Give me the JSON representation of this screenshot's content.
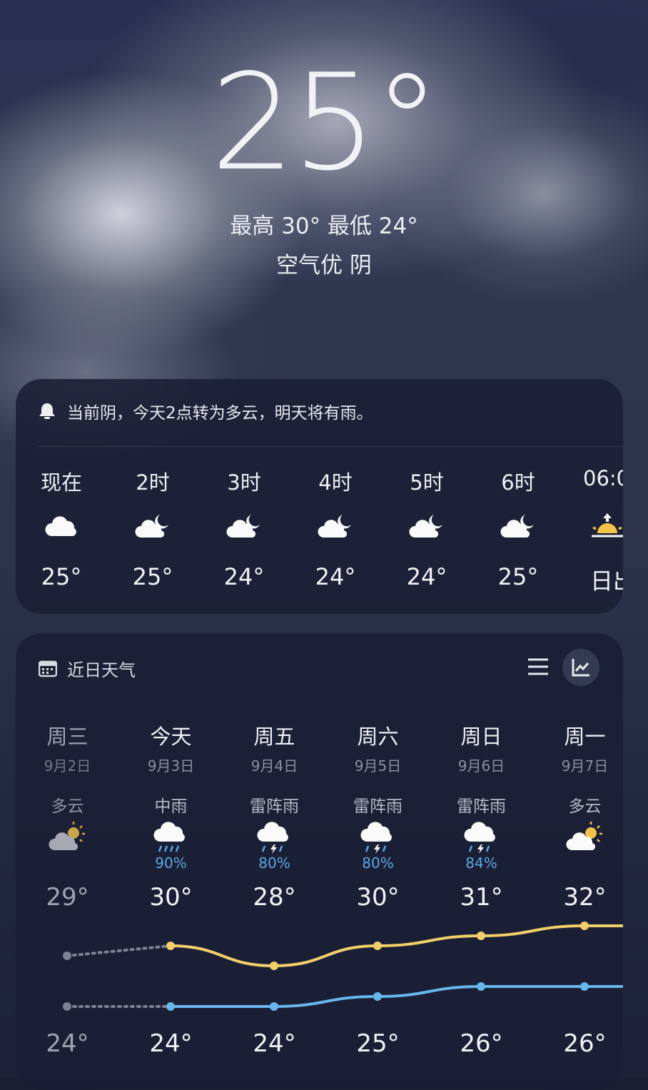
{
  "current": {
    "temperature": "25°",
    "high_low": "最高 30° 最低 24°",
    "air_and_condition": "空气优  阴"
  },
  "alert": {
    "text": "当前阴，今天2点转为多云，明天将有雨。",
    "icon": "bell-icon"
  },
  "hourly": [
    {
      "time": "现在",
      "icon": "cloudy-icon",
      "temp": "25°"
    },
    {
      "time": "2时",
      "icon": "partly-cloudy-night-icon",
      "temp": "25°"
    },
    {
      "time": "3时",
      "icon": "partly-cloudy-night-icon",
      "temp": "24°"
    },
    {
      "time": "4时",
      "icon": "partly-cloudy-night-icon",
      "temp": "24°"
    },
    {
      "time": "5时",
      "icon": "partly-cloudy-night-icon",
      "temp": "24°"
    },
    {
      "time": "6时",
      "icon": "partly-cloudy-night-icon",
      "temp": "25°"
    },
    {
      "time": "06:0",
      "icon": "sunrise-icon",
      "temp": "日出"
    }
  ],
  "forecast": {
    "title": "近日天气",
    "title_icon": "calendar-icon",
    "list_view_icon": "list-view-icon",
    "chart_view_icon": "chart-view-icon",
    "days": [
      {
        "weekday": "周三",
        "date": "9月2日",
        "condition": "多云",
        "icon": "partly-cloudy-day-icon",
        "precip": "",
        "high": "29°",
        "low": "24°",
        "past": true
      },
      {
        "weekday": "今天",
        "date": "9月3日",
        "condition": "中雨",
        "icon": "rain-icon",
        "precip": "90%",
        "high": "30°",
        "low": "24°",
        "past": false
      },
      {
        "weekday": "周五",
        "date": "9月4日",
        "condition": "雷阵雨",
        "icon": "thunderstorm-icon",
        "precip": "80%",
        "high": "28°",
        "low": "24°",
        "past": false
      },
      {
        "weekday": "周六",
        "date": "9月5日",
        "condition": "雷阵雨",
        "icon": "thunderstorm-icon",
        "precip": "80%",
        "high": "30°",
        "low": "25°",
        "past": false
      },
      {
        "weekday": "周日",
        "date": "9月6日",
        "condition": "雷阵雨",
        "icon": "thunderstorm-icon",
        "precip": "84%",
        "high": "31°",
        "low": "26°",
        "past": false
      },
      {
        "weekday": "周一",
        "date": "9月7日",
        "condition": "多云",
        "icon": "partly-cloudy-day-icon",
        "precip": "",
        "high": "32°",
        "low": "26°",
        "past": false
      }
    ],
    "colors": {
      "high_line": "#f3cf6a",
      "low_line": "#67b6ec",
      "past_line": "#7d8193"
    }
  }
}
